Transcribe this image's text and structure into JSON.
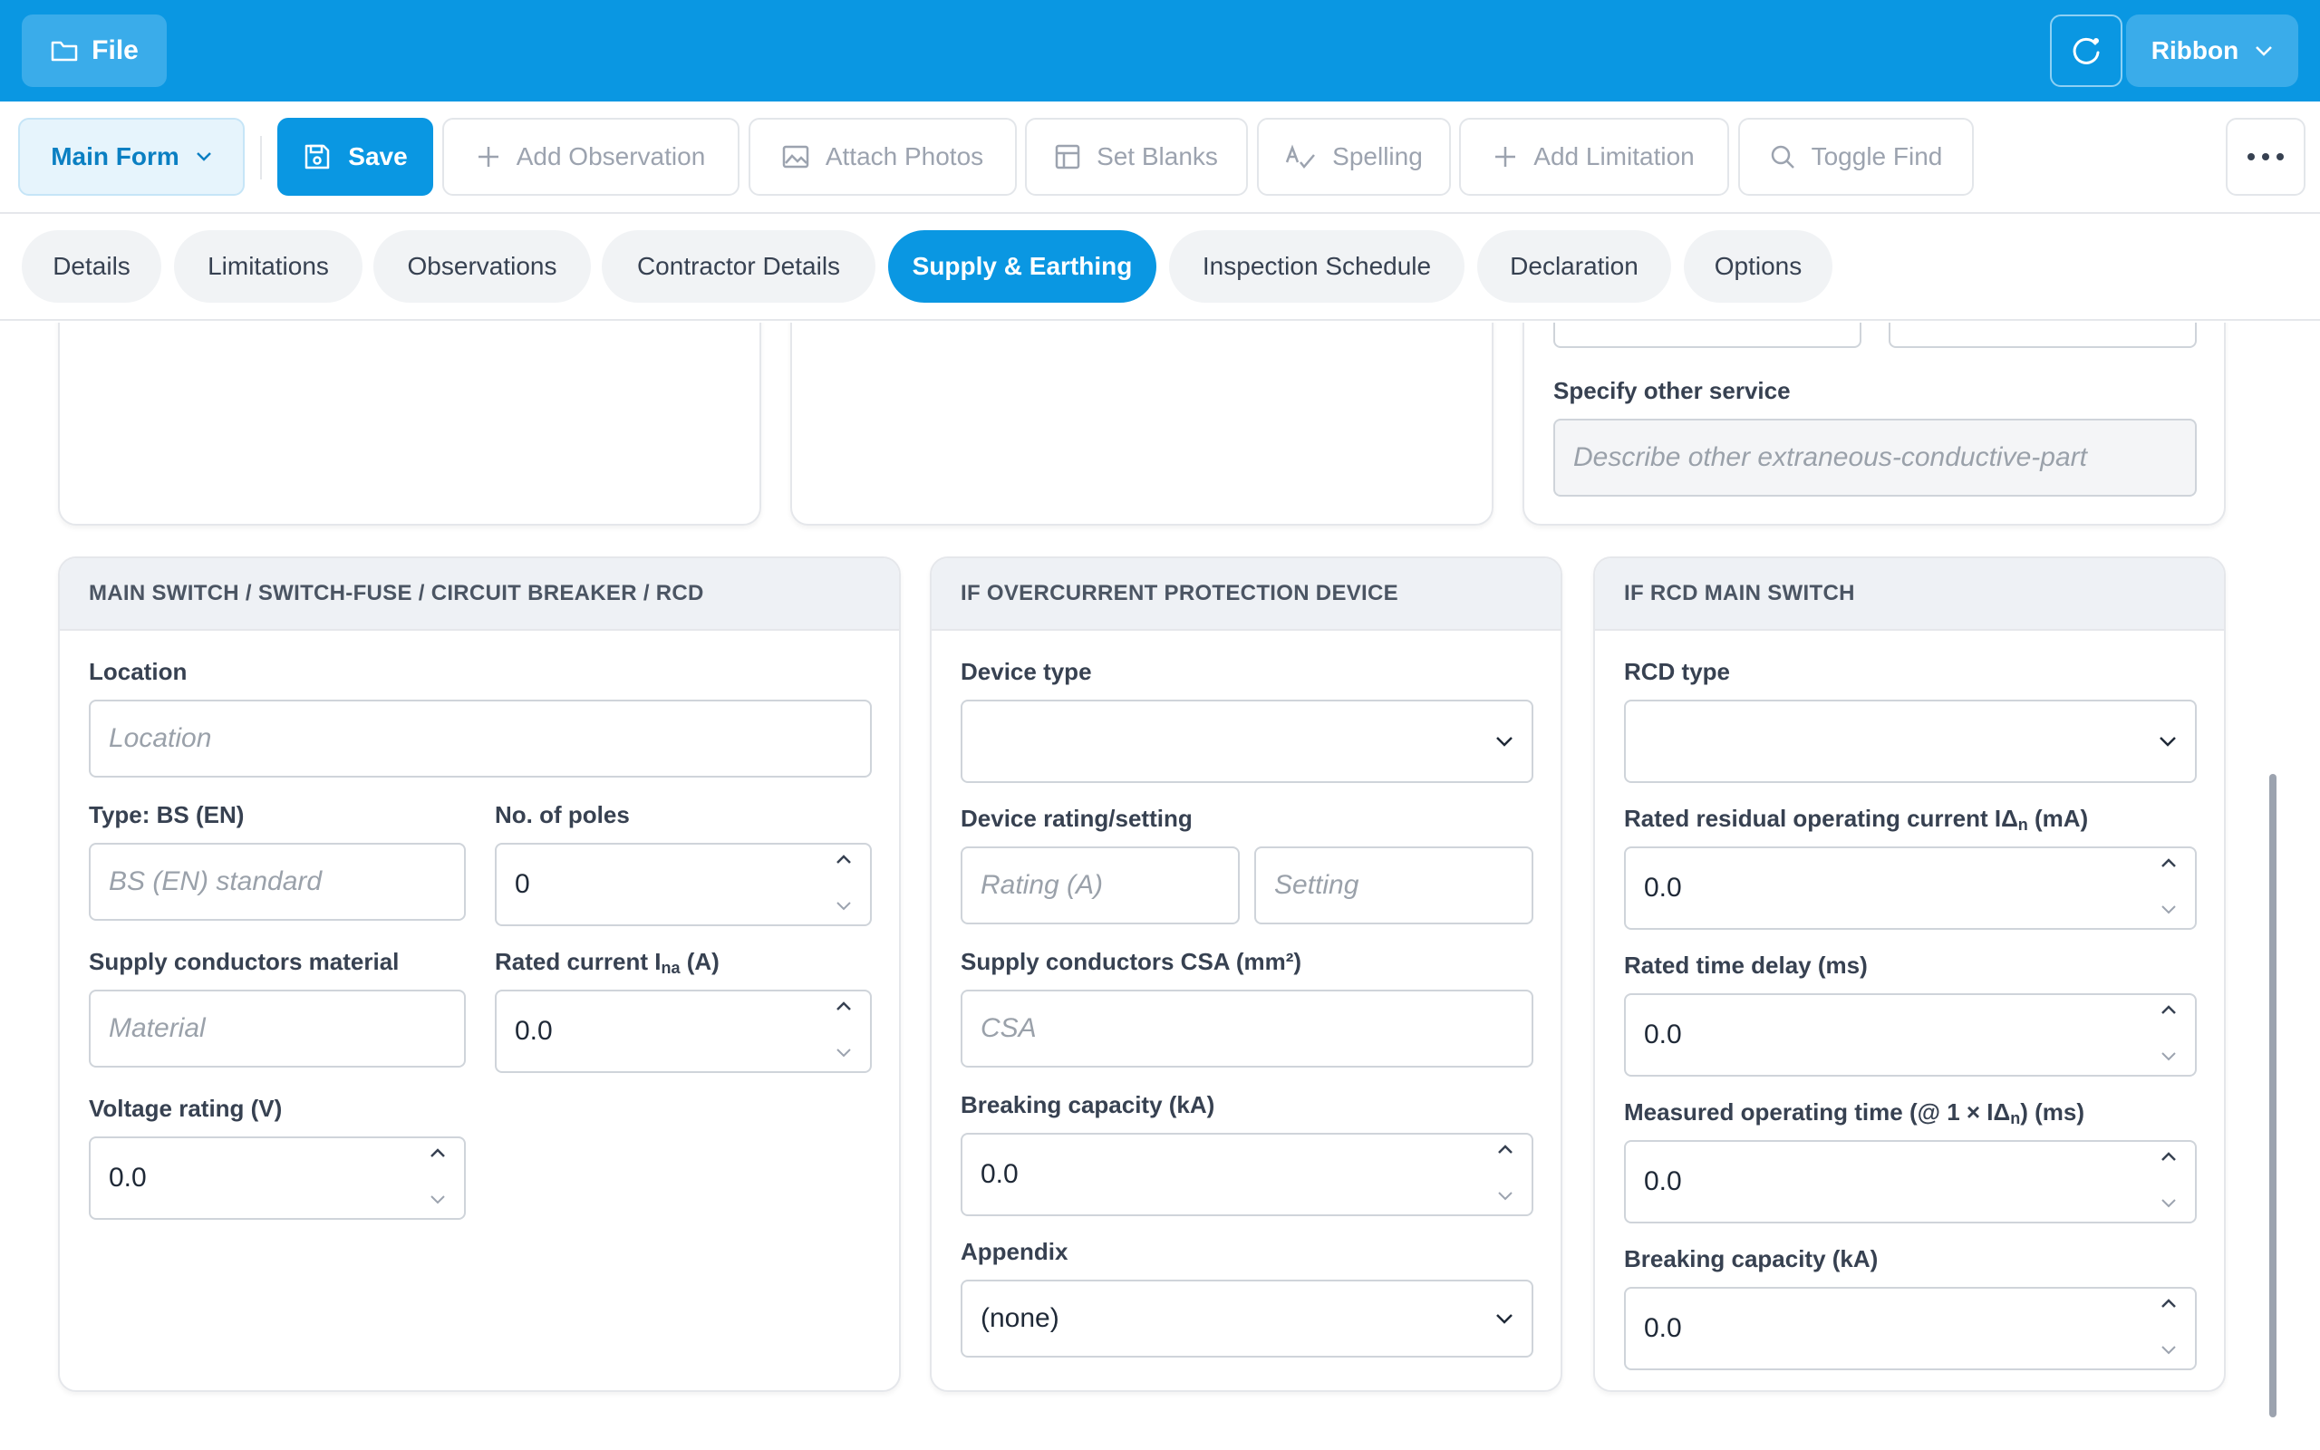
{
  "topbar": {
    "file_label": "File",
    "ribbon_label": "Ribbon",
    "accent_color": "#0a97e2"
  },
  "toolbar": {
    "main_form_label": "Main Form",
    "save_label": "Save",
    "add_observation_label": "Add Observation",
    "attach_photos_label": "Attach Photos",
    "set_blanks_label": "Set Blanks",
    "spelling_label": "Spelling",
    "add_limitation_label": "Add Limitation",
    "toggle_find_label": "Toggle Find"
  },
  "tabs": [
    {
      "label": "Details"
    },
    {
      "label": "Limitations"
    },
    {
      "label": "Observations"
    },
    {
      "label": "Contractor Details"
    },
    {
      "label": "Supply & Earthing",
      "active": true
    },
    {
      "label": "Inspection Schedule"
    },
    {
      "label": "Declaration"
    },
    {
      "label": "Options"
    }
  ],
  "upper": {
    "specify_other_label": "Specify other service",
    "specify_other_placeholder": "Describe other extraneous-conductive-part"
  },
  "main_switch": {
    "title": "MAIN SWITCH / SWITCH-FUSE / CIRCUIT BREAKER / RCD",
    "location_label": "Location",
    "location_placeholder": "Location",
    "type_label": "Type: BS (EN)",
    "type_placeholder": "BS (EN) standard",
    "poles_label": "No. of poles",
    "poles_value": "0",
    "material_label": "Supply conductors material",
    "material_placeholder": "Material",
    "rated_current_label": "Rated current I",
    "rated_current_sub": "na",
    "rated_current_unit": " (A)",
    "rated_current_value": "0.0",
    "voltage_label": "Voltage rating (V)",
    "voltage_value": "0.0"
  },
  "overcurrent": {
    "title": "IF OVERCURRENT PROTECTION DEVICE",
    "device_type_label": "Device type",
    "device_type_value": "",
    "rating_label": "Device rating/setting",
    "rating_placeholder": "Rating (A)",
    "setting_placeholder": "Setting",
    "csa_label": "Supply conductors CSA (mm²)",
    "csa_placeholder": "CSA",
    "breaking_label": "Breaking capacity (kA)",
    "breaking_value": "0.0",
    "appendix_label": "Appendix",
    "appendix_value": "(none)"
  },
  "rcd": {
    "title": "IF RCD MAIN SWITCH",
    "type_label": "RCD type",
    "type_value": "",
    "residual_label": "Rated residual operating current IΔ",
    "residual_sub": "n",
    "residual_unit": " (mA)",
    "residual_value": "0.0",
    "delay_label": "Rated time delay (ms)",
    "delay_value": "0.0",
    "measured_label": "Measured operating time (@ 1 × IΔ",
    "measured_sub": "n",
    "measured_unit": ") (ms)",
    "measured_value": "0.0",
    "breaking_label": "Breaking capacity (kA)",
    "breaking_value": "0.0"
  }
}
